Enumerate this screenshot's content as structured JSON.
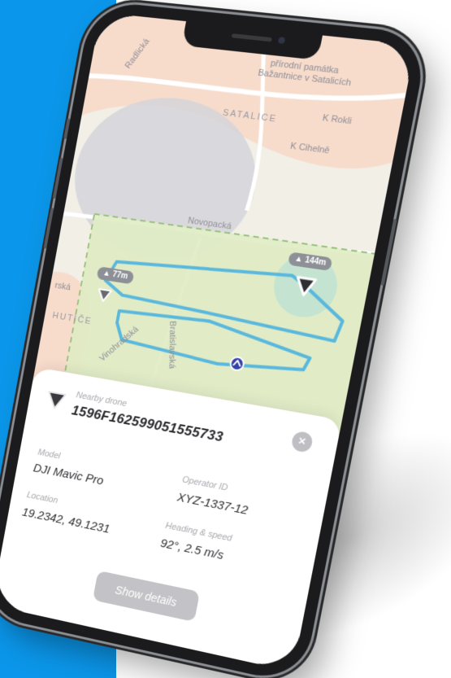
{
  "map": {
    "labels": {
      "monument_line1": "přírodní památka",
      "monument_line2": "Bažantnice v Satalicích",
      "district_satalice": "SATALICE",
      "street_k_rokli": "K Rokli",
      "street_k_cihelne": "K Cihelně",
      "street_novopacka": "Novopacká",
      "district_hutie": "HUTÍČE",
      "street_left": "rská",
      "street_top_left": "Radlická",
      "street_vertical_1": "Vinohradská",
      "street_vertical_2": "Bratislavská"
    },
    "drones": [
      {
        "altitude": "144m",
        "selected": true
      },
      {
        "altitude": "77m",
        "selected": false
      }
    ],
    "colors": {
      "flight_path": "#5ab8dc",
      "zone_fill": "#e0ebc4",
      "zone_border": "#9cc282",
      "restricted_fill": "#f7d6c4",
      "grey_zone": "#d5d5db",
      "user_location": "#3441a8"
    }
  },
  "sheet": {
    "kicker": "Nearby drone",
    "drone_id": "1596F162599051555733",
    "close_icon": "close-icon",
    "fields": {
      "model_label": "Model",
      "model_value": "DJI Mavic Pro",
      "operator_label": "Operator ID",
      "operator_value": "XYZ-1337-12",
      "location_label": "Location",
      "location_value": "19.2342, 49.1231",
      "heading_label": "Heading & speed",
      "heading_value": "92°, 2.5 m/s"
    },
    "show_details_label": "Show details"
  },
  "colors": {
    "background_band": "#0a96ea",
    "phone_frame": "#1b1b1d"
  }
}
